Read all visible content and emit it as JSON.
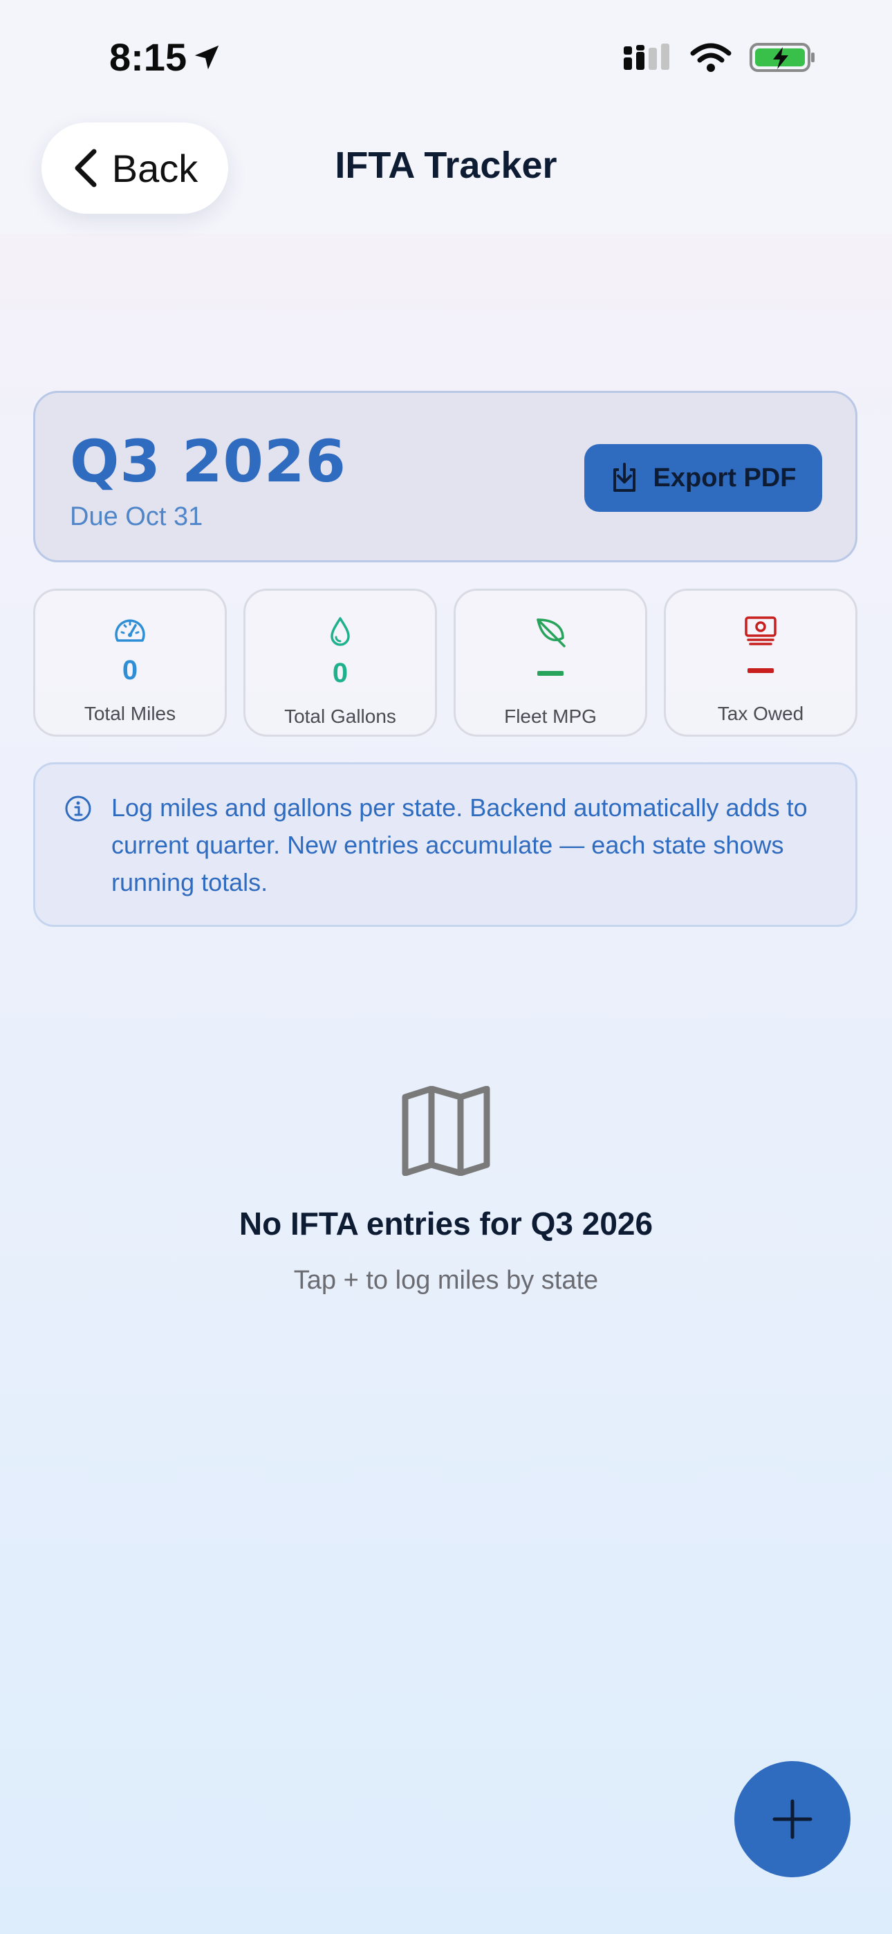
{
  "status_bar": {
    "time": "8:15"
  },
  "nav": {
    "back_label": "Back",
    "title": "IFTA Tracker"
  },
  "quarter": {
    "title": "Q3 2026",
    "due": "Due Oct 31",
    "export_label": "Export PDF"
  },
  "stats": [
    {
      "icon": "speedometer-icon",
      "value": "0",
      "label": "Total Miles",
      "color": "#2f8fd6"
    },
    {
      "icon": "fuel-drop-icon",
      "value": "0",
      "label": "Total Gallons",
      "color": "#1fb08c"
    },
    {
      "icon": "leaf-icon",
      "value": "",
      "label": "Fleet MPG",
      "color": "#28a35b"
    },
    {
      "icon": "cash-icon",
      "value": "",
      "label": "Tax Owed",
      "color": "#c81e1e"
    }
  ],
  "info": {
    "text": "Log miles and gallons per state. Backend automatically adds to current quarter. New entries accumulate — each state shows running totals."
  },
  "empty_state": {
    "title": "No IFTA entries for Q3 2026",
    "subtitle": "Tap + to log miles by state"
  },
  "colors": {
    "accent": "#2f6bbf",
    "title": "#0d1b33"
  }
}
